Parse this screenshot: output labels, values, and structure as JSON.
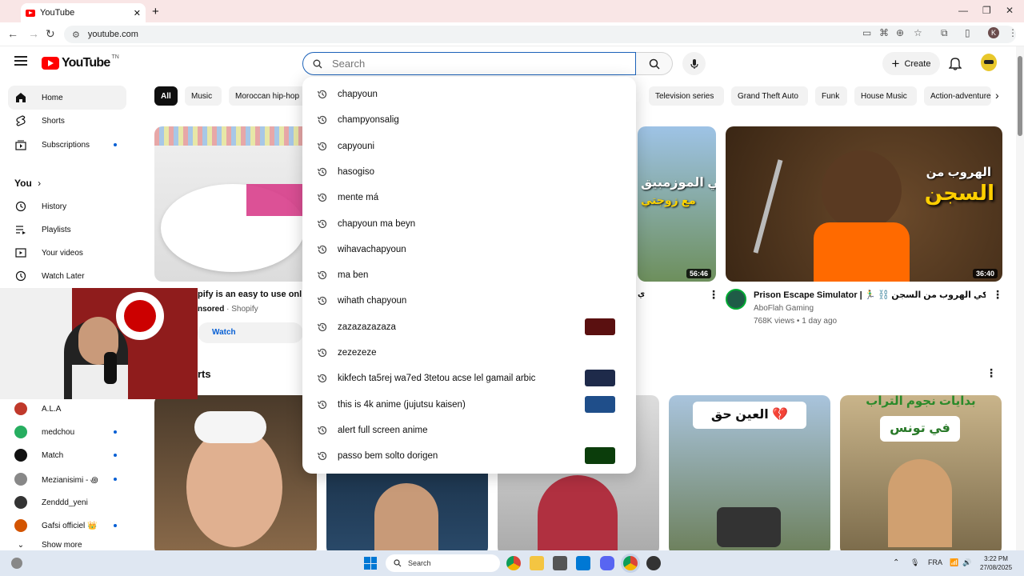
{
  "browser": {
    "tab_title": "YouTube",
    "tab_close": "✕",
    "new_tab": "+",
    "url": "youtube.com",
    "profile_initial": "K",
    "window_controls": [
      "—",
      "❐",
      "✕"
    ]
  },
  "header": {
    "logo_text": "YouTube",
    "logo_tn": "TN",
    "search_placeholder": "Search",
    "create_label": "Create"
  },
  "sidebar": {
    "main": [
      {
        "label": "Home",
        "icon": "home-icon",
        "active": true
      },
      {
        "label": "Shorts",
        "icon": "shorts-icon"
      },
      {
        "label": "Subscriptions",
        "icon": "subscriptions-icon",
        "dot": true
      }
    ],
    "you_header": "You",
    "you_chevron": "›",
    "you_items": [
      {
        "label": "History",
        "icon": "history-icon"
      },
      {
        "label": "Playlists",
        "icon": "playlists-icon"
      },
      {
        "label": "Your videos",
        "icon": "your-videos-icon"
      },
      {
        "label": "Watch Later",
        "icon": "watch-later-icon"
      }
    ],
    "subscriptions": [
      {
        "label": "A.L.A",
        "color": "#c0392b"
      },
      {
        "label": "medchou",
        "color": "#27ae60",
        "dot": true
      },
      {
        "label": "Match",
        "color": "#111111",
        "dot": true
      },
      {
        "label": "Mezianisimi - ꩜",
        "color": "#888888",
        "dot": true
      },
      {
        "label": "Zenddd_yeni",
        "color": "#333333"
      },
      {
        "label": "Gafsi officiel 👑",
        "color": "#d35400",
        "dot": true
      }
    ],
    "show_more": "Show more"
  },
  "chips": [
    "All",
    "Music",
    "Moroccan hip-hop",
    "Television series",
    "Grand Theft Auto",
    "Funk",
    "House Music",
    "Action-adventure"
  ],
  "videos": [
    {
      "title": "Prison Escape Simulator | 🏃‍♂️ ⛓️ محاكي الهروب من السجن",
      "channel": "AboFlah Gaming",
      "meta": "768K views • 1 day ago",
      "duration": "36:40",
      "overlay_text_1": "الهروب من",
      "overlay_text_2": "السجن"
    },
    {
      "duration": "56:46",
      "overlay_text_1": "في الموزمبيق",
      "overlay_text_2": "مع زوجتي"
    }
  ],
  "ad": {
    "title": "pify is an easy to use onl",
    "sponsored": "nsored",
    "dot": "·",
    "advertiser": "Shopify",
    "watch_label": "Watch"
  },
  "shorts_label": "rts",
  "shorts": [
    {
      "overlay_text": "العين حق 💔"
    },
    {
      "overlay_text_1": "بدايات نجوم التراب",
      "overlay_text_2": "في تونس"
    }
  ],
  "suggestions": [
    {
      "text": "chapyoun"
    },
    {
      "text": "champyonsalig"
    },
    {
      "text": "capyouni"
    },
    {
      "text": "hasogiso"
    },
    {
      "text": "mente má"
    },
    {
      "text": "chapyoun ma beyn"
    },
    {
      "text": "wihavachapyoun"
    },
    {
      "text": "ma ben"
    },
    {
      "text": "wihath chapyoun"
    },
    {
      "text": "zazazazazaza",
      "thumb": "#5a1010"
    },
    {
      "text": "zezezeze"
    },
    {
      "text": "kikfech ta5rej wa7ed 3tetou acse lel gamail arbic",
      "thumb": "#1e2a4a"
    },
    {
      "text": "this is 4k anime (jujutsu kaisen)",
      "thumb": "#1f4e8a"
    },
    {
      "text": "alert full screen anime"
    },
    {
      "text": "passo bem solto dorigen",
      "thumb": "#0b3d0b"
    }
  ],
  "taskbar": {
    "search": "Search",
    "lang": "FRA",
    "time": "3:22 PM",
    "date": "27/08/2025"
  }
}
